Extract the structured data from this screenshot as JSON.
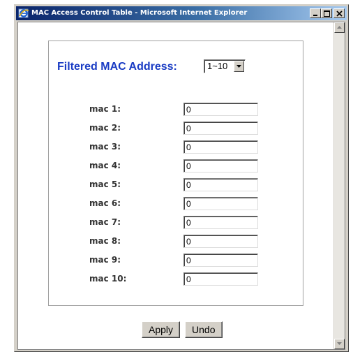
{
  "window": {
    "title": "MAC Access Control Table - Microsoft Internet Explorer",
    "icon": "internet-explorer-icon",
    "caption_buttons": [
      "minimize",
      "maximize",
      "close"
    ]
  },
  "form": {
    "filter_label": "Filtered MAC Address:",
    "filter_selected": "1~10",
    "rows": [
      {
        "label": "mac 1:",
        "value": "0"
      },
      {
        "label": "mac 2:",
        "value": "0"
      },
      {
        "label": "mac 3:",
        "value": "0"
      },
      {
        "label": "mac 4:",
        "value": "0"
      },
      {
        "label": "mac 5:",
        "value": "0"
      },
      {
        "label": "mac 6:",
        "value": "0"
      },
      {
        "label": "mac 7:",
        "value": "0"
      },
      {
        "label": "mac 8:",
        "value": "0"
      },
      {
        "label": "mac 9:",
        "value": "0"
      },
      {
        "label": "mac 10:",
        "value": "0"
      }
    ]
  },
  "buttons": {
    "apply_label": "Apply",
    "undo_label": "Undo"
  },
  "colors": {
    "label_blue": "#1a3cc4",
    "titlebar_dark": "#0a246a",
    "face": "#d4d0c8"
  }
}
